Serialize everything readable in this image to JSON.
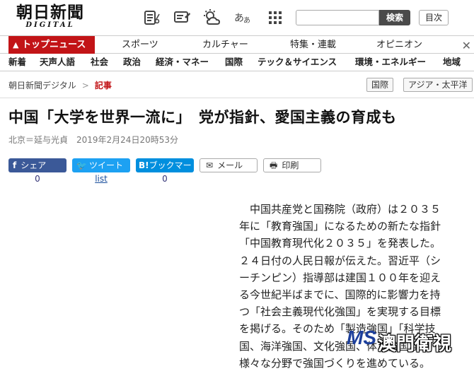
{
  "header": {
    "logo_main": "朝日新聞",
    "logo_sub": "DIGITAL",
    "search_button": "検索",
    "toc_button": "目次",
    "search_placeholder": ""
  },
  "nav_primary": {
    "top": "トップニュース",
    "items": [
      "スポーツ",
      "カルチャー",
      "特集・連載",
      "オピニオン"
    ]
  },
  "nav_secondary": {
    "items": [
      "新着",
      "天声人語",
      "社会",
      "政治",
      "経済・マネー",
      "国際",
      "テック＆サイエンス",
      "環境・エネルギー",
      "地域"
    ]
  },
  "breadcrumb": {
    "home": "朝日新聞デジタル",
    "sep": ">",
    "current": "記事",
    "tags": [
      "国際",
      "アジア・太平洋"
    ]
  },
  "article": {
    "title": "中国「大学を世界一流に」　党が指針、愛国主義の育成も",
    "byline": "北京＝延与光貞　2019年2月24日20時53分",
    "body_lines": [
      "中国共産党と国務院（政府）は２０３５",
      "年に「教育強国」になるための新たな指針",
      "「中国教育現代化２０３５」を発表した。",
      "２４日付の人民日報が伝えた。習近平（シ",
      "ーチンピン）指導部は建国１００年を迎え",
      "る今世紀半ばまでに、国際的に影響力を持",
      "つ「社会主義現代化強国」を実現する目標",
      "を掲げる。そのため「製造強国」「科学技",
      "国、海洋強国、文化強国、体育強国など",
      "様々な分野で強国づくりを進めている。"
    ]
  },
  "share": {
    "facebook": "シェア",
    "twitter": "ツイート",
    "hatena": "ブックマー",
    "mail": "メール",
    "print": "印刷",
    "facebook_count": "0",
    "twitter_count": "list",
    "hatena_count": "0"
  },
  "watermark": {
    "ms": "MS",
    "text": "澳門衛視"
  }
}
